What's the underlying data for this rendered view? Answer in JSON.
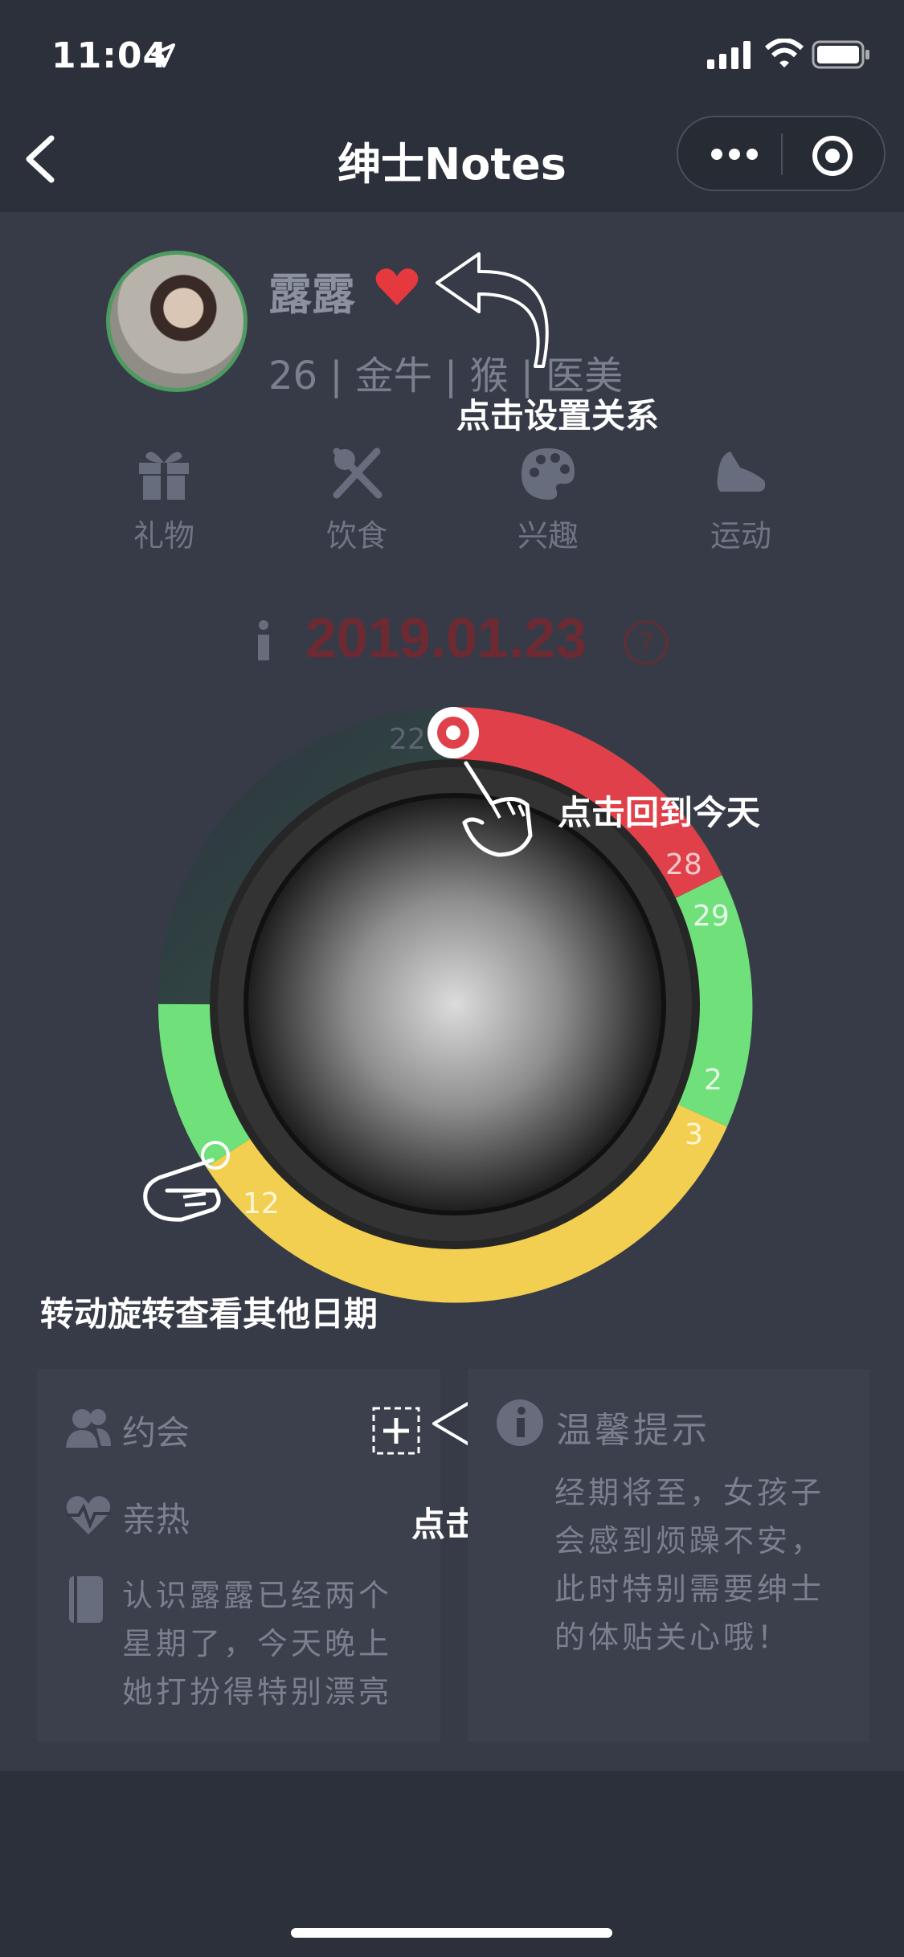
{
  "status": {
    "time": "11:04"
  },
  "nav": {
    "title": "绅士Notes"
  },
  "profile": {
    "name": "露露",
    "info": "26 | 金牛 | 猴 | 医美"
  },
  "hints": {
    "set_relation": "点击设置关系",
    "back_today": "点击回到今天",
    "rotate": "转动旋转查看其他日期",
    "add_event": "点击添加事件"
  },
  "categories": [
    {
      "label": "礼物",
      "icon": "gift-icon"
    },
    {
      "label": "饮食",
      "icon": "utensils-icon"
    },
    {
      "label": "兴趣",
      "icon": "palette-icon"
    },
    {
      "label": "运动",
      "icon": "sneaker-icon"
    }
  ],
  "date": "2019.01.23",
  "dial": {
    "day_labels": [
      "22",
      "28",
      "29",
      "2",
      "3",
      "12"
    ],
    "colors": {
      "period": "#e04049",
      "safe": "#6fe07a",
      "ovulation": "#f2cf50"
    }
  },
  "events": {
    "date_label": "约会",
    "intimacy_label": "亲热",
    "note": [
      "认识露露已经两个",
      "星期了，今天晚上",
      "她打扮得特别漂亮"
    ]
  },
  "tip": {
    "title": "温馨提示",
    "lines": [
      "经期将至，女孩子",
      "会感到烦躁不安，",
      "此时特别需要绅士",
      "的体贴关心哦！"
    ]
  }
}
